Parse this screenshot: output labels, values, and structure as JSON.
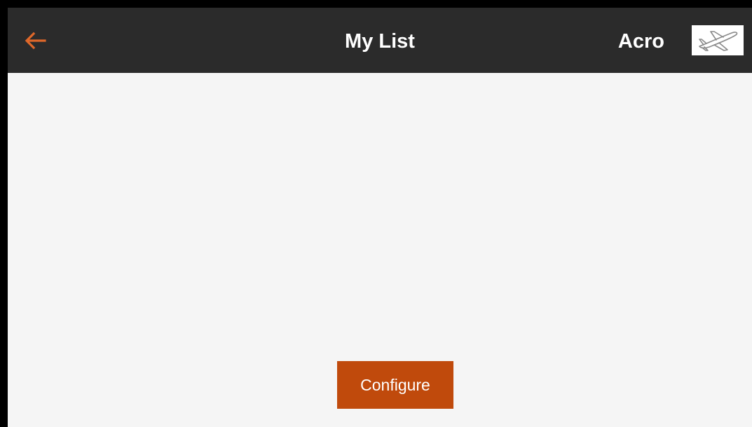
{
  "header": {
    "title": "My List",
    "back_icon": "arrow-left-icon",
    "model_name": "Acro",
    "model_icon": "airplane-icon"
  },
  "main": {
    "configure_label": "Configure"
  },
  "colors": {
    "header_bg": "#2b2b2b",
    "accent": "#e0682a",
    "button_bg": "#c04a0c",
    "screen_bg": "#f5f5f5"
  }
}
